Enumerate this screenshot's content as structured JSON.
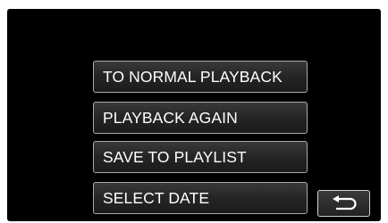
{
  "menu": {
    "items": [
      {
        "label": "TO NORMAL PLAYBACK"
      },
      {
        "label": "PLAYBACK AGAIN"
      },
      {
        "label": "SAVE TO PLAYLIST"
      },
      {
        "label": "SELECT DATE"
      }
    ]
  },
  "return_button": {
    "icon": "return-arrow-icon"
  }
}
